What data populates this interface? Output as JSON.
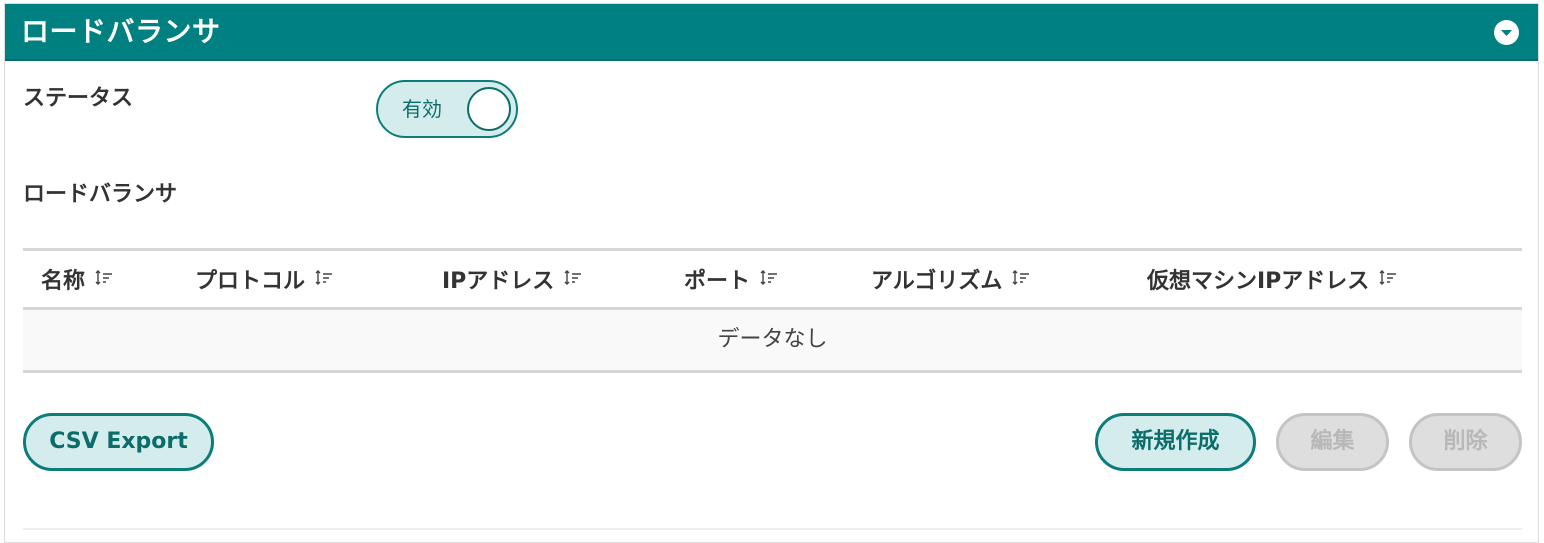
{
  "header": {
    "title": "ロードバランサ",
    "collapse_icon": "chevron-down-circle-icon"
  },
  "status": {
    "label": "ステータス",
    "toggle_text": "有効",
    "enabled": true
  },
  "section": {
    "label": "ロードバランサ"
  },
  "table": {
    "columns": [
      {
        "label": "名称",
        "icon": "sort-icon"
      },
      {
        "label": "プロトコル",
        "icon": "sort-icon"
      },
      {
        "label": "IPアドレス",
        "icon": "sort-icon"
      },
      {
        "label": "ポート",
        "icon": "sort-icon"
      },
      {
        "label": "アルゴリズム",
        "icon": "sort-icon"
      },
      {
        "label": "仮想マシンIPアドレス",
        "icon": "sort-icon"
      }
    ],
    "empty_text": "データなし"
  },
  "actions": {
    "csv_export": "CSV Export",
    "create": "新規作成",
    "edit": "編集",
    "delete": "削除"
  },
  "colors": {
    "accent": "#008080",
    "accent_light": "#d4ecec",
    "disabled": "#dedede"
  }
}
